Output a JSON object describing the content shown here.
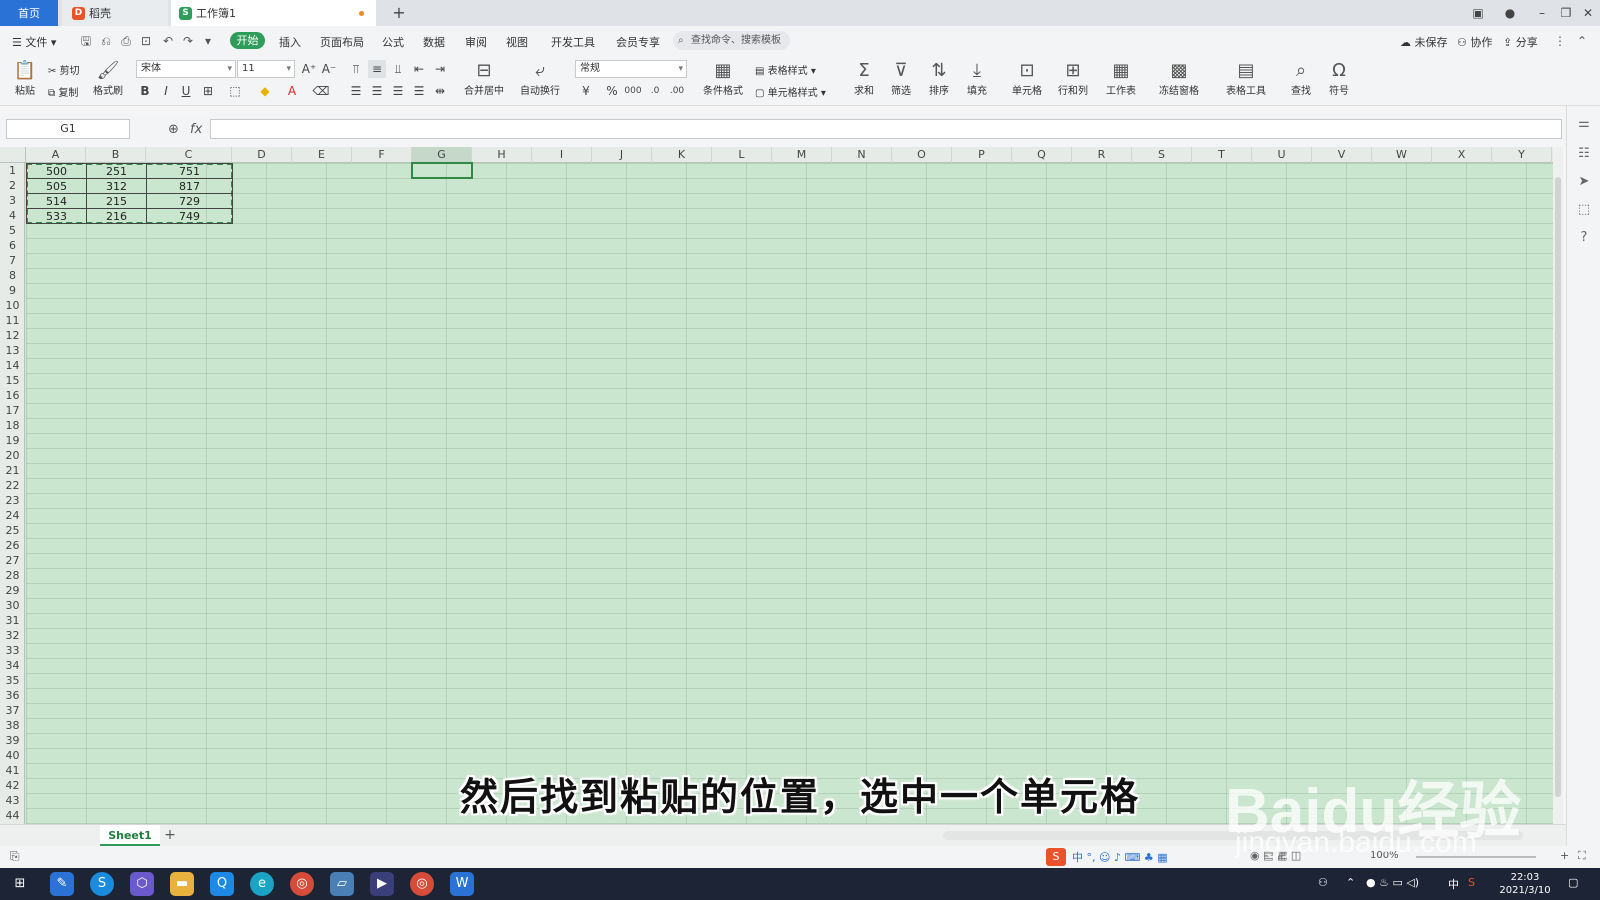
{
  "tabs": {
    "home": "首页",
    "docer": "稻壳",
    "workbook": "工作簿1",
    "add": "+"
  },
  "menu": {
    "file": "文件",
    "start": "开始",
    "items": [
      "插入",
      "页面布局",
      "公式",
      "数据",
      "审阅",
      "视图",
      "开发工具",
      "会员专享"
    ],
    "search_placeholder": "查找命令、搜索模板",
    "unsaved": "未保存",
    "collab": "协作",
    "share": "分享"
  },
  "ribbon": {
    "paste": "粘贴",
    "cut": "剪切",
    "copy": "复制",
    "format_painter": "格式刷",
    "font_name": "宋体",
    "font_size": "11",
    "merge_center": "合并居中",
    "wrap_text": "自动换行",
    "number_format": "常规",
    "cond_format": "条件格式",
    "table_style": "表格样式",
    "cell_style": "单元格样式",
    "sum": "求和",
    "filter": "筛选",
    "sort": "排序",
    "fill": "填充",
    "cells": "单元格",
    "rows_cols": "行和列",
    "worksheet": "工作表",
    "freeze": "冻结窗格",
    "table_tools": "表格工具",
    "find": "查找",
    "symbol": "符号"
  },
  "formula_bar": {
    "name_box": "G1",
    "fx": "fx",
    "value": ""
  },
  "columns": [
    "A",
    "B",
    "C",
    "D",
    "E",
    "F",
    "G",
    "H",
    "I",
    "J",
    "K",
    "L",
    "M",
    "N",
    "O",
    "P",
    "Q",
    "R",
    "S",
    "T",
    "U",
    "V",
    "W",
    "X",
    "Y"
  ],
  "rows": [
    "1",
    "2",
    "3",
    "4",
    "5",
    "6",
    "7",
    "8",
    "9",
    "10",
    "11",
    "12",
    "13",
    "14",
    "15",
    "16",
    "17",
    "18",
    "19",
    "20",
    "21",
    "22",
    "23",
    "24",
    "25",
    "26",
    "27",
    "28",
    "29",
    "30",
    "31",
    "32",
    "33",
    "34",
    "35",
    "36",
    "37",
    "38",
    "39",
    "40",
    "41",
    "42",
    "43",
    "44"
  ],
  "table": [
    [
      "500",
      "251",
      "751"
    ],
    [
      "505",
      "312",
      "817"
    ],
    [
      "514",
      "215",
      "729"
    ],
    [
      "533",
      "216",
      "749"
    ]
  ],
  "selected_column": "G",
  "sheet": {
    "name": "Sheet1",
    "add": "+"
  },
  "status": {
    "zoom": "100%"
  },
  "taskbar": {
    "time": "22:03",
    "date": "2021/3/10",
    "ime": "中"
  },
  "subtitle": "然后找到粘贴的位置，选中一个单元格",
  "watermark": {
    "brand": "Baidu经验",
    "url": "jingyan.baidu.com"
  },
  "colors": {
    "accent": "#2e9d5a",
    "sheet_bg": "#cbe6cf",
    "home_tab": "#2b72d6"
  }
}
